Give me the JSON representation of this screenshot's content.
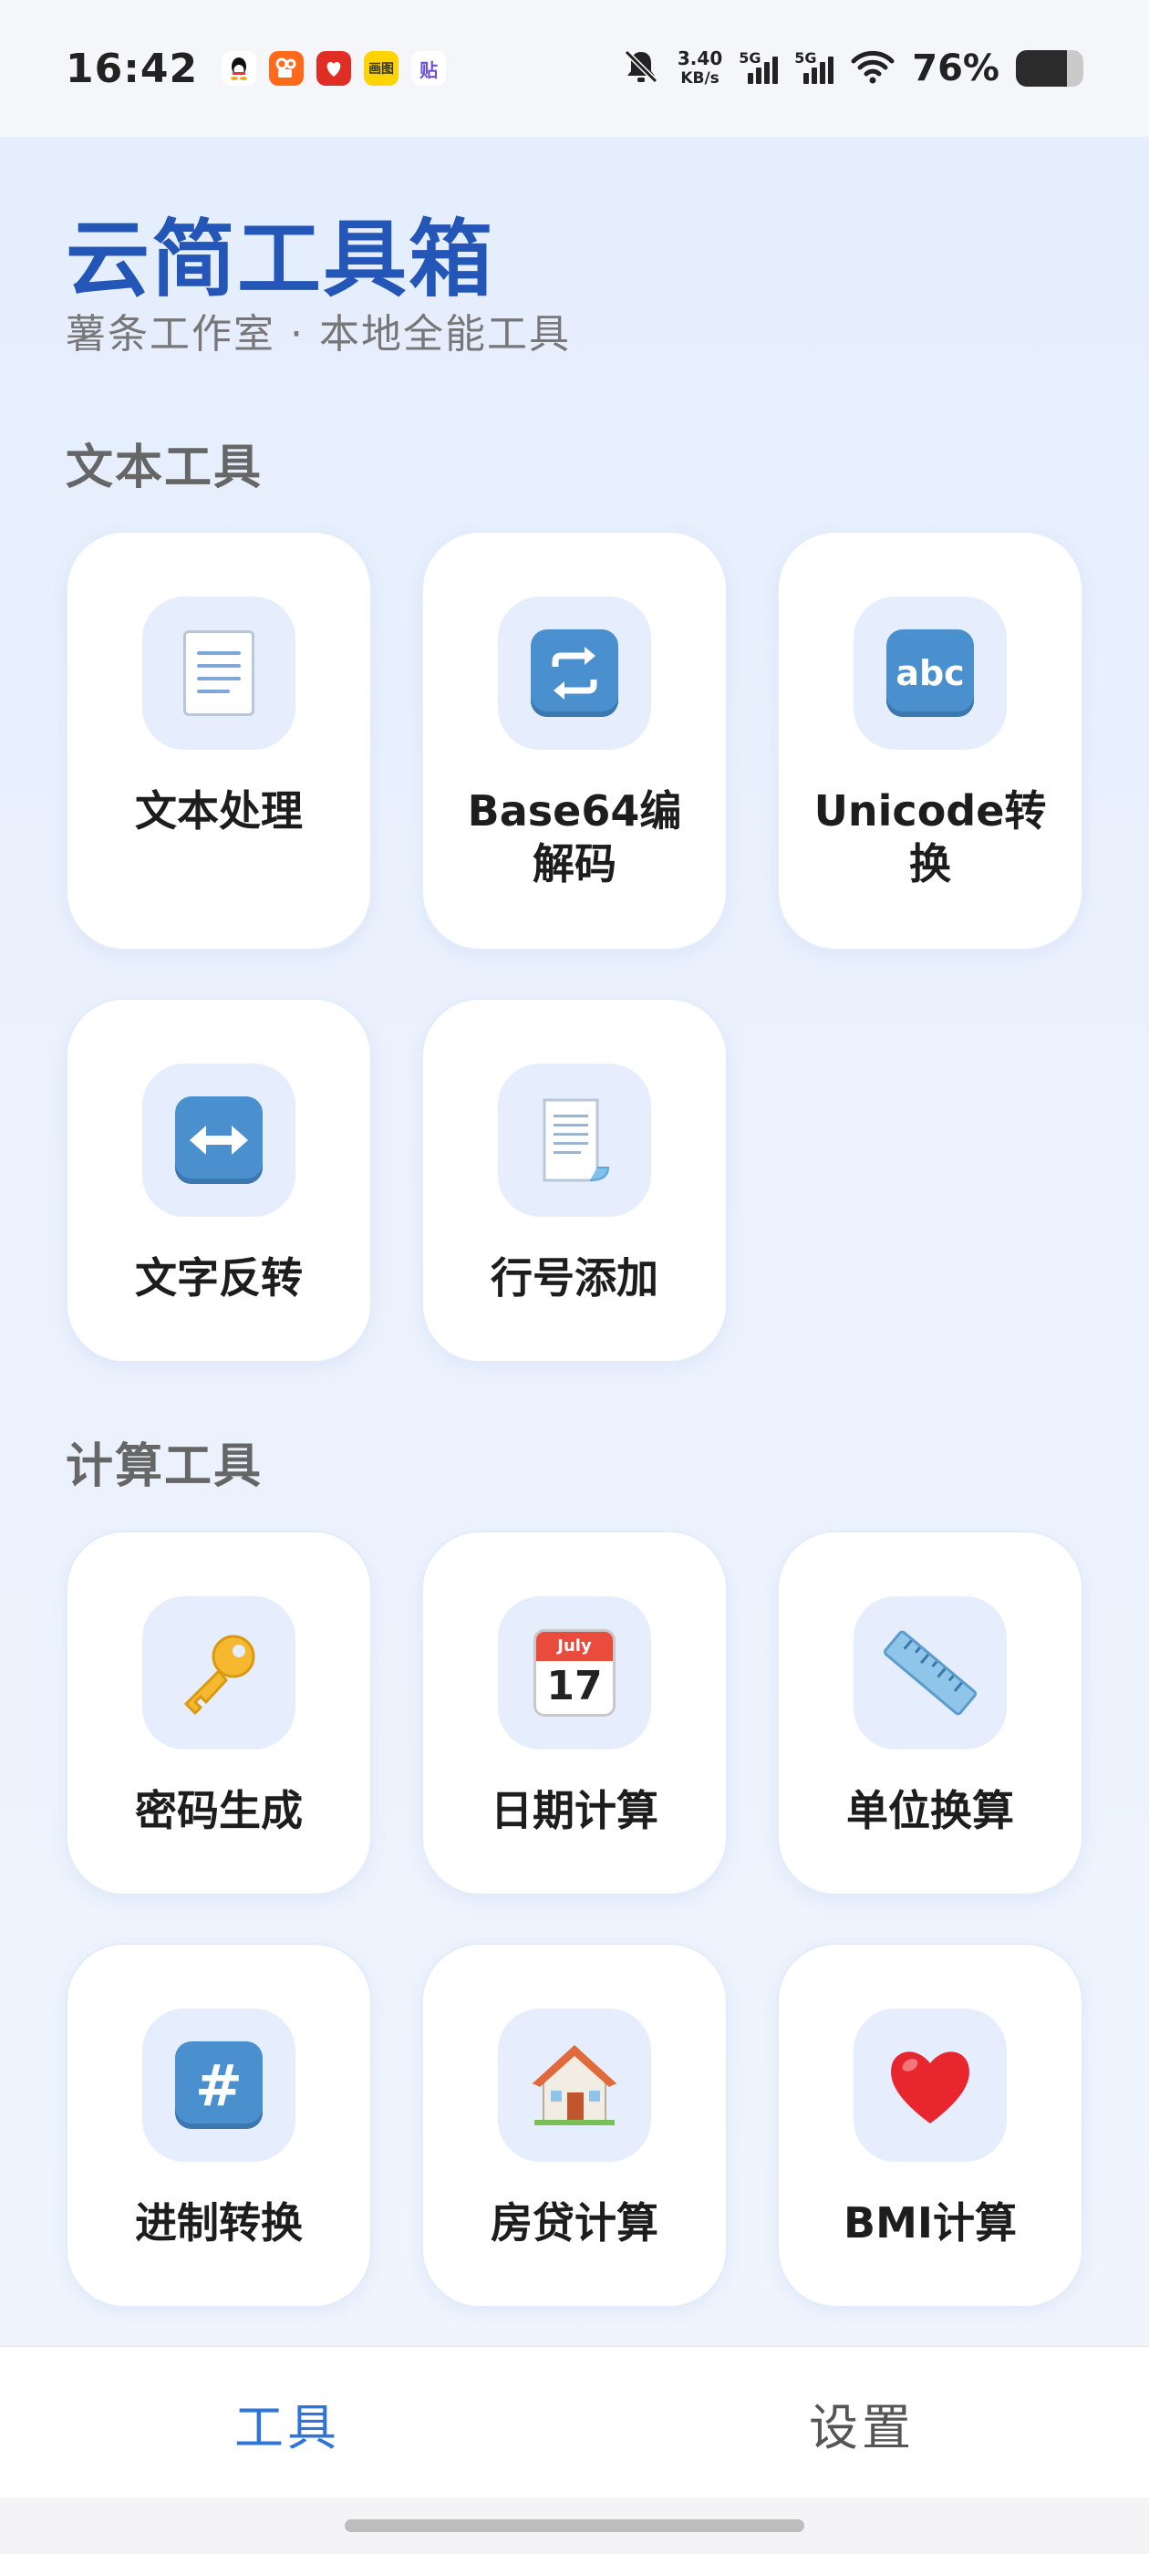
{
  "status_bar": {
    "time": "16:42",
    "net_speed_value": "3.40",
    "net_speed_unit": "KB/s",
    "signal_1": "5G",
    "signal_2": "5G",
    "battery_pct": "76%",
    "battery_level": 0.76,
    "notification_icons": [
      "qq-icon",
      "kuaishou-icon",
      "pinduoduo-icon",
      "app-icon",
      "tieba-icon"
    ],
    "notif_icon_1_text": "",
    "notif_icon_4_text": "画图",
    "notif_icon_5_text": "贴"
  },
  "header": {
    "title": "云简工具箱",
    "subtitle": "薯条工作室 · 本地全能工具"
  },
  "sections": [
    {
      "title": "文本工具",
      "tools": [
        {
          "label": "文本处理",
          "icon": "page-document-icon"
        },
        {
          "label": "Base64编解码",
          "icon": "arrows-repeat-icon"
        },
        {
          "label": "Unicode转换",
          "icon": "abc-icon",
          "icon_text": "abc"
        },
        {
          "label": "文字反转",
          "icon": "left-right-arrow-icon"
        },
        {
          "label": "行号添加",
          "icon": "page-curl-icon"
        }
      ]
    },
    {
      "title": "计算工具",
      "tools": [
        {
          "label": "密码生成",
          "icon": "key-icon"
        },
        {
          "label": "日期计算",
          "icon": "calendar-icon",
          "icon_month": "July",
          "icon_day": "17"
        },
        {
          "label": "单位换算",
          "icon": "ruler-icon"
        },
        {
          "label": "进制转换",
          "icon": "keycap-hash-icon",
          "icon_text": "#"
        },
        {
          "label": "房贷计算",
          "icon": "house-icon"
        },
        {
          "label": "BMI计算",
          "icon": "heart-icon"
        }
      ]
    }
  ],
  "bottom_nav": {
    "tabs": [
      {
        "label": "工具",
        "active": true
      },
      {
        "label": "设置",
        "active": false
      }
    ]
  },
  "colors": {
    "accent": "#2f74d8",
    "title_blue": "#2456b8",
    "icon_bg": "#e6eefd"
  }
}
